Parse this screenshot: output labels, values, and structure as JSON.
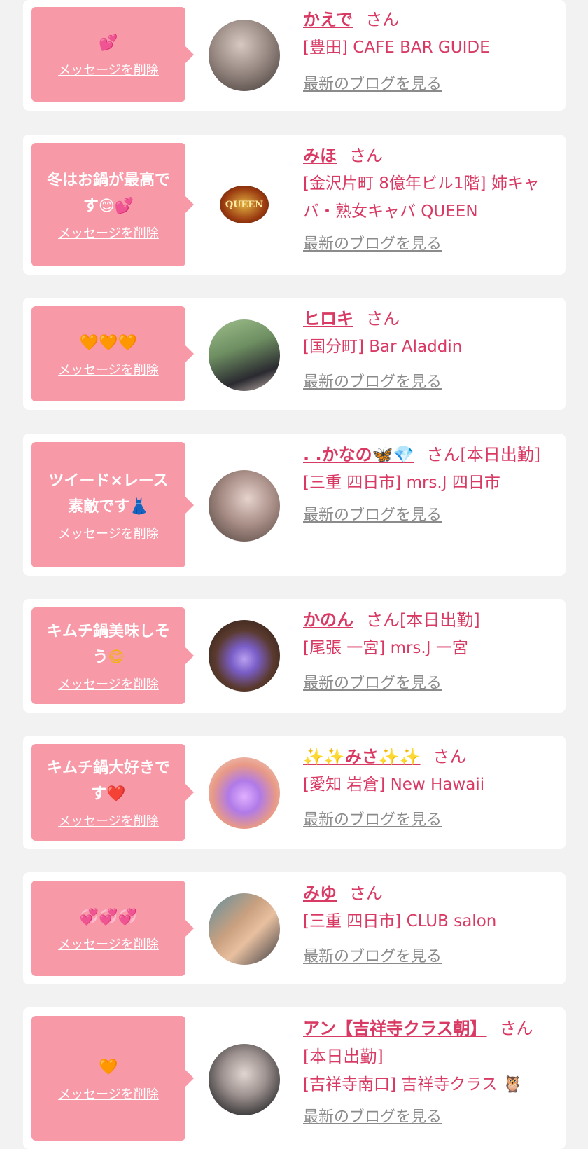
{
  "delete_label": "メッセージを削除",
  "blog_label": "最新のブログを見る",
  "san_label": "さん",
  "cards": [
    {
      "message": "",
      "emoji": "💕",
      "name": "かえで",
      "san_suffix": "",
      "shop": "[豊田] CAFE BAR GUIDE",
      "avatar_colors": [
        "#c9b8b0",
        "#5a4c45"
      ]
    },
    {
      "message": "冬はお鍋が最高で\nす",
      "emoji": "😊💕",
      "name": "みほ",
      "san_suffix": "",
      "shop": "[金沢片町 8億年ビル1階] 姉キャバ・熟女キャバ QUEEN",
      "logo_text": "QUEEN",
      "avatar_colors": [
        "#ffffff",
        "#ffffff"
      ]
    },
    {
      "message": "",
      "emoji": "🧡🧡🧡",
      "name": "ヒロキ",
      "san_suffix": "",
      "shop": "[国分町] Bar Aladdin",
      "avatar_colors": [
        "#8fae7e",
        "#2c2a2e"
      ]
    },
    {
      "message": "ツイード×レース\n素敵です",
      "emoji": "👗",
      "name": ". .かなの🦋💎",
      "san_suffix": "[本日出勤]",
      "shop": "[三重 四日市] mrs.J 四日市",
      "avatar_colors": [
        "#b7a39b",
        "#5b4944"
      ]
    },
    {
      "message": "キムチ鍋美味しそ\nう",
      "emoji": "😋",
      "name": "かのん",
      "san_suffix": "[本日出勤]",
      "shop": "[尾張 一宮] mrs.J 一宮",
      "avatar_colors": [
        "#9a7ad8",
        "#3a2a22"
      ]
    },
    {
      "message": "キムチ鍋大好きで\nす",
      "emoji": "❤️",
      "name": "✨✨みさ✨✨",
      "san_suffix": "",
      "shop": "[愛知 岩倉] New Hawaii",
      "avatar_colors": [
        "#d9a0f0",
        "#e27a6a"
      ]
    },
    {
      "message": "",
      "emoji": "💞💞💞",
      "name": "みゆ",
      "san_suffix": "",
      "shop": "[三重 四日市] CLUB salon",
      "avatar_colors": [
        "#c89a7a",
        "#4c6d7e"
      ]
    },
    {
      "message": "",
      "emoji": "🧡",
      "name": "アン【吉祥寺クラス朝】",
      "san_suffix": "[本日出勤]",
      "shop": "[吉祥寺南口] 吉祥寺クラス 🦉",
      "avatar_colors": [
        "#b8b4b2",
        "#2b2b2b"
      ]
    }
  ],
  "colors": {
    "accent": "#d93a64",
    "bubble": "#f899a8",
    "background": "#f2f2f3"
  }
}
